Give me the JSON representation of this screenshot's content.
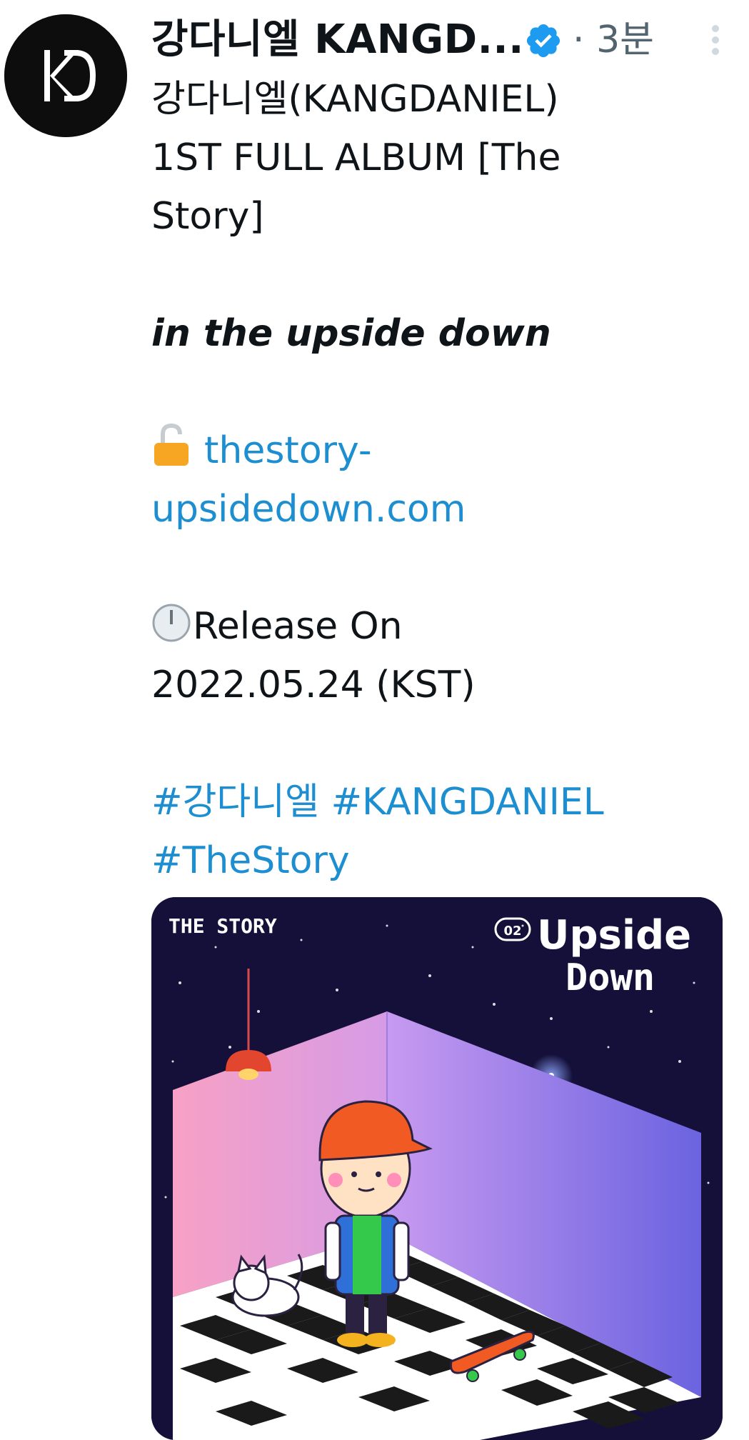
{
  "author": {
    "display_name": "강다니엘 KANGD...",
    "verified_icon": "verified-badge-icon",
    "separator": "·",
    "timestamp": "3분",
    "avatar_logo": "KD"
  },
  "tweet": {
    "title_line1": "강다니엘(KANGDANIEL)",
    "title_line2": "1ST FULL ALBUM [The",
    "title_line3": "Story]",
    "subtitle": "in the upside down",
    "link_line1": "thestory-",
    "link_line2": "upsidedown.com",
    "release_line1": "Release On",
    "release_line2": "2022.05.24 (KST)",
    "hashtags_line1": [
      "#강다니엘",
      "#KANGDANIEL"
    ],
    "hashtags_line2": [
      "#TheStory"
    ]
  },
  "media": {
    "brand_top": "THE STORY",
    "badge": "02",
    "title_line1": "Upside",
    "title_line2": "Down"
  },
  "colors": {
    "link": "#1d8fd1",
    "text": "#0f1419",
    "muted": "#536471",
    "verified": "#1d9bf0",
    "space_bg": "#15103a"
  }
}
